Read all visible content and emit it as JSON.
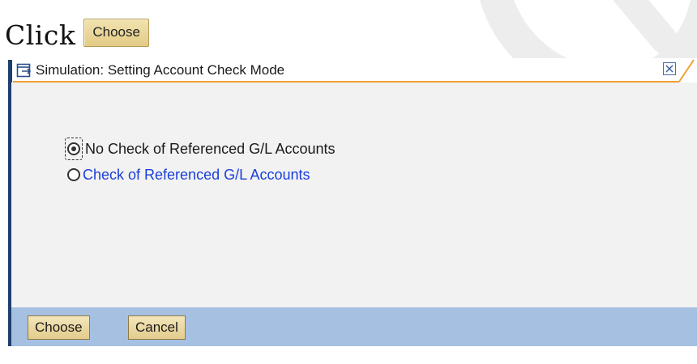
{
  "instruction": {
    "text": "Click",
    "inline_button_label": "Choose"
  },
  "dialog": {
    "title": "Simulation: Setting Account Check Mode",
    "icons": {
      "window": "dialog-window-icon",
      "close": "close-icon"
    },
    "options": [
      {
        "label": "No Check of Referenced G/L Accounts",
        "selected": true
      },
      {
        "label": "Check of Referenced G/L Accounts",
        "selected": false
      }
    ],
    "buttons": {
      "choose": "Choose",
      "cancel": "Cancel"
    }
  },
  "colors": {
    "accent_orange": "#f0a030",
    "footer_blue": "#a6c0e2",
    "link_blue": "#1a3fd9",
    "button_gold": "#e3cc8c",
    "frame_navy": "#1f3f6e"
  }
}
